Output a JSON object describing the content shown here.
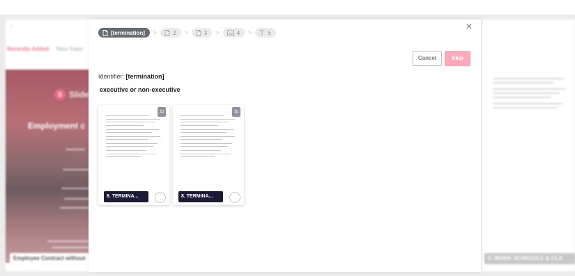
{
  "background": {
    "left_tabs": [
      "Recently Added",
      "Your Favo"
    ],
    "left_logo_letter": "S",
    "left_logo_word": "Slidel",
    "left_hero_title": "Employment c",
    "left_card_label": "Employee Contract without",
    "right_card_label": "5. WORK SCHEDULE & CLA"
  },
  "modal": {
    "steps": [
      {
        "label": "[termination]",
        "icon": "document-icon",
        "active": true
      },
      {
        "label": "2",
        "icon": "document-icon",
        "active": false
      },
      {
        "label": "3",
        "icon": "document-icon",
        "active": false
      },
      {
        "label": "4",
        "icon": "image-icon",
        "active": false
      },
      {
        "label": "5",
        "icon": "text-icon",
        "active": false
      }
    ],
    "step_separator": ">",
    "close_label": "×",
    "cancel_label": "Cancel",
    "skip_label": "Skip",
    "identifier_prefix": "Identifier:",
    "identifier_value": "[termination]",
    "question": "executive or non-executive",
    "cards": [
      {
        "page_badge": "1p",
        "tag": "8. TERMINA..."
      },
      {
        "page_badge": "1p",
        "tag": "8. TERMINA..."
      }
    ]
  },
  "colors": {
    "accent": "#fba8b9",
    "step_active": "#666b72",
    "card_tag": "#1d1a36"
  }
}
